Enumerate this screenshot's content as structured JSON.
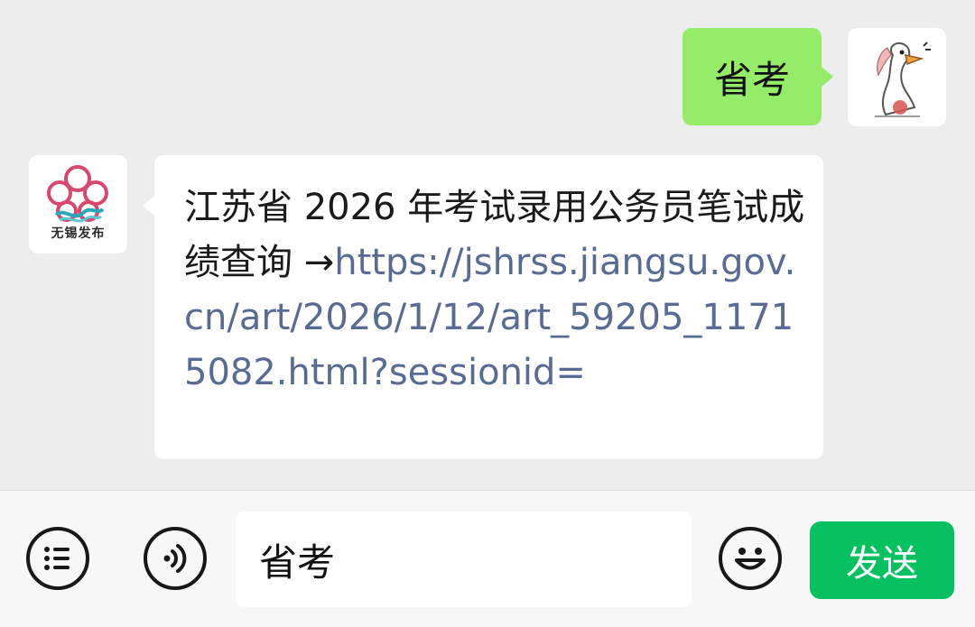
{
  "messages": [
    {
      "direction": "outgoing",
      "avatar": "goose-sticker-avatar",
      "text": "省考"
    },
    {
      "direction": "incoming",
      "avatar": "wuxi-fabu-logo-avatar",
      "avatar_label": "无锡发布",
      "text": "江苏省 2026 年考试录用公务员笔试成绩查询 →",
      "link": "https://jshrss.jiangsu.gov.cn/art/2026/1/12/art_59205_11715082.html?sessionid="
    }
  ],
  "input_bar": {
    "menu_icon": "list-menu-icon",
    "voice_icon": "voice-icon",
    "input_value": "省考",
    "emoji_icon": "emoji-icon",
    "send_label": "发送"
  },
  "colors": {
    "background": "#ededed",
    "outgoing_bubble": "#95ec69",
    "incoming_bubble": "#ffffff",
    "link": "#576b95",
    "send_button": "#07c160",
    "input_bar": "#f7f7f7"
  }
}
